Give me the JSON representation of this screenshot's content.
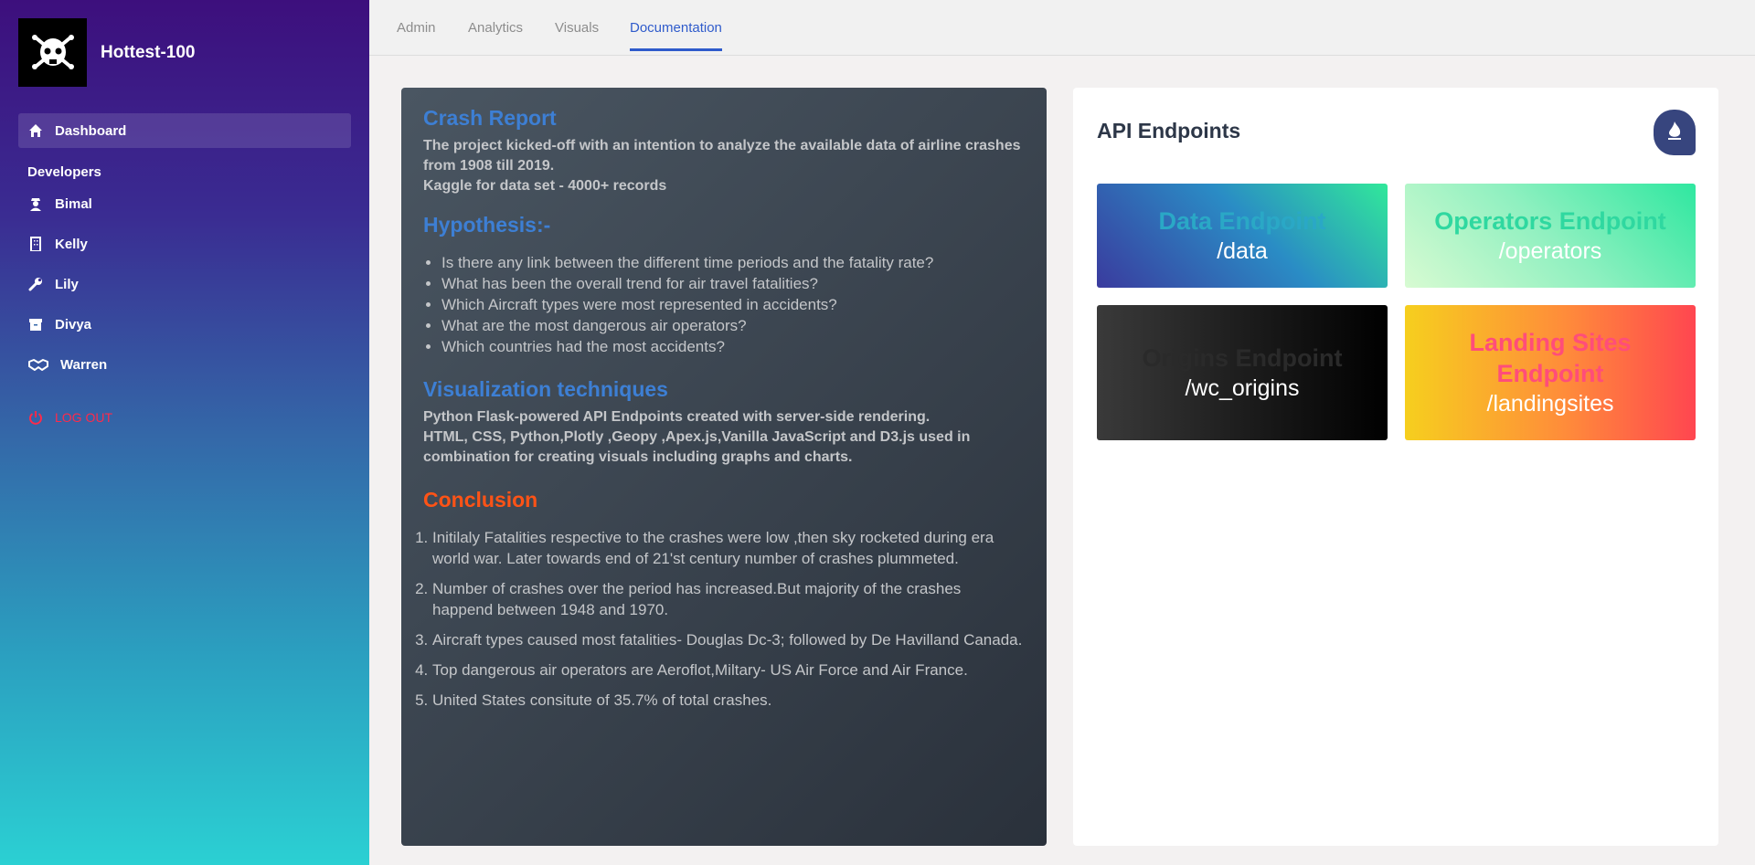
{
  "app": {
    "title": "Hottest-100"
  },
  "sidebar": {
    "items": [
      {
        "label": "Dashboard",
        "icon": "home-icon"
      },
      {
        "label": "Bimal",
        "icon": "user-secret-icon"
      },
      {
        "label": "Kelly",
        "icon": "building-icon"
      },
      {
        "label": "Lily",
        "icon": "wrench-icon"
      },
      {
        "label": "Divya",
        "icon": "archive-icon"
      },
      {
        "label": "Warren",
        "icon": "handshake-icon"
      }
    ],
    "section_heading": "Developers",
    "logout_label": "LOG OUT"
  },
  "tabs": [
    "Admin",
    "Analytics",
    "Visuals",
    "Documentation"
  ],
  "report": {
    "title": "Crash Report",
    "intro_1": "The project kicked-off with an intention to analyze the available data of airline crashes from 1908 till 2019.",
    "intro_2": "Kaggle for data set - 4000+ records",
    "hypothesis_title": "Hypothesis:-",
    "hypotheses": [
      "Is there any link between the different time periods and the fatality rate?",
      "What has been the overall trend for air travel fatalities?",
      "Which Aircraft types were most represented in accidents?",
      "What are the most dangerous air operators?",
      "Which countries had the most accidents?"
    ],
    "viz_title": "Visualization techniques",
    "viz_1": "Python Flask-powered API Endpoints created with server-side rendering.",
    "viz_2": "HTML, CSS, Python,Plotly ,Geopy ,Apex.js,Vanilla JavaScript and D3.js used in combination for creating visuals including graphs and charts.",
    "conclusion_title": "Conclusion",
    "conclusions": [
      "Initilaly Fatalities respective to the crashes were low ,then sky rocketed during era world war. Later towards end of 21'st century number of crashes plummeted.",
      "Number of crashes over the period has increased.But majority of the crashes happend between 1948 and 1970.",
      "Aircraft types caused most fatalities- Douglas Dc-3; followed by De Havilland Canada.",
      "Top dangerous air operators are Aeroflot,Miltary- US Air Force and Air France.",
      "United States consitute of 35.7% of total crashes."
    ]
  },
  "api": {
    "title": "API Endpoints",
    "endpoints": [
      {
        "name": "Data Endpoint",
        "path": "/data",
        "name_color": "#2aa8c6"
      },
      {
        "name": "Operators Endpoint",
        "path": "/operators",
        "name_color": "#2fd8a0"
      },
      {
        "name": "Origins Endpoint",
        "path": "/wc_origins",
        "name_color": "#2a2a2a"
      },
      {
        "name": "Landing Sites Endpoint",
        "path": "/landingsites",
        "name_color": "#ff4d7a"
      }
    ]
  },
  "colors": {
    "accent": "#2f5bcb",
    "report_heading": "#3d7fd4",
    "conclusion_heading": "#ff5316",
    "logout": "#ff2a4a"
  }
}
